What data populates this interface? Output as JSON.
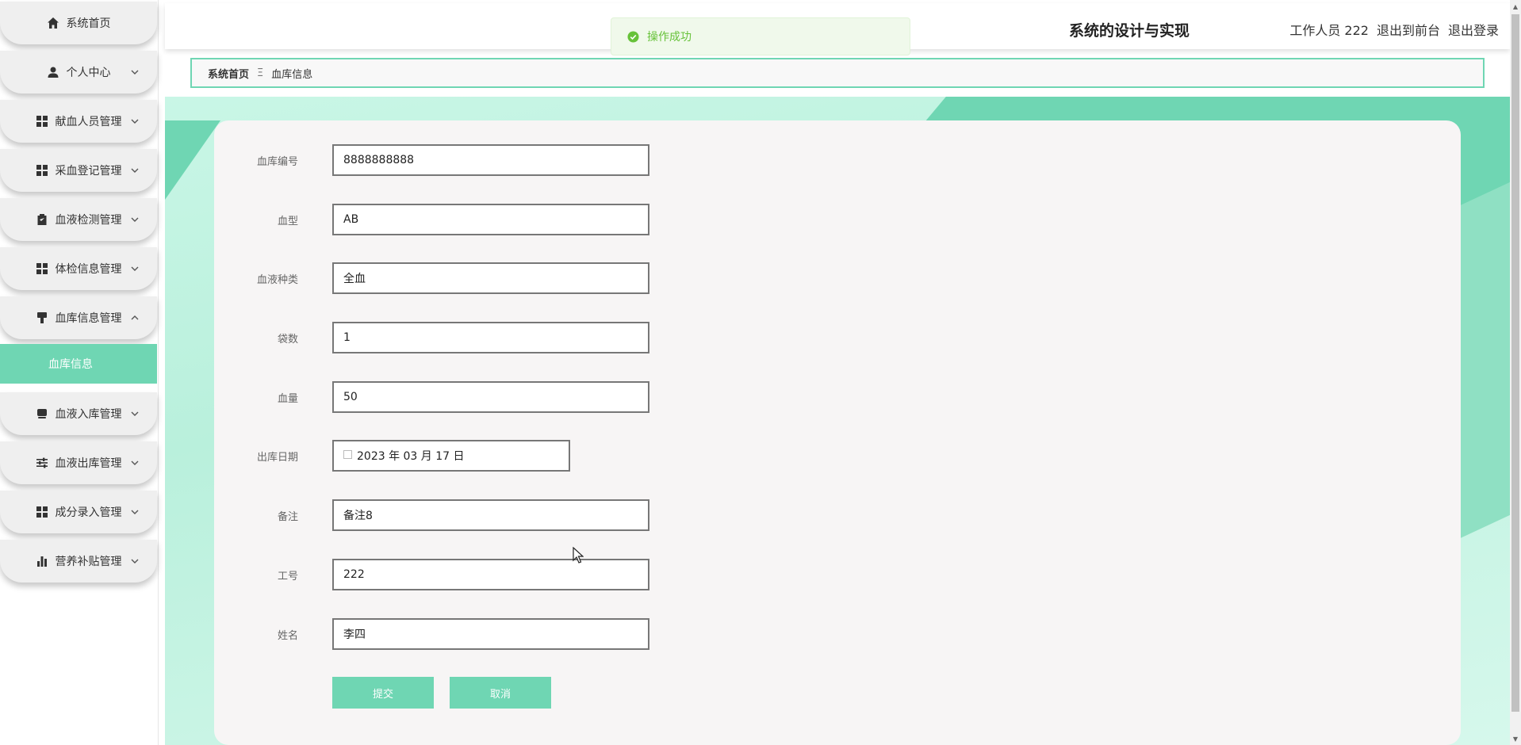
{
  "sidebar": {
    "items": [
      {
        "label": "系统首页",
        "icon": "home-icon",
        "has_chevron": false
      },
      {
        "label": "个人中心",
        "icon": "user-icon",
        "has_chevron": true
      },
      {
        "label": "献血人员管理",
        "icon": "grid-icon",
        "has_chevron": true
      },
      {
        "label": "采血登记管理",
        "icon": "grid-icon",
        "has_chevron": true
      },
      {
        "label": "血液检测管理",
        "icon": "clipboard-icon",
        "has_chevron": true
      },
      {
        "label": "体检信息管理",
        "icon": "grid-icon",
        "has_chevron": true
      },
      {
        "label": "血库信息管理",
        "icon": "brush-icon",
        "has_chevron": true,
        "expanded": true
      },
      {
        "label": "血液入库管理",
        "icon": "inbox-icon",
        "has_chevron": true
      },
      {
        "label": "血液出库管理",
        "icon": "sliders-icon",
        "has_chevron": true
      },
      {
        "label": "成分录入管理",
        "icon": "grid-icon",
        "has_chevron": true
      },
      {
        "label": "营养补贴管理",
        "icon": "bar-chart-icon",
        "has_chevron": true
      }
    ],
    "active_sub": "血库信息"
  },
  "header": {
    "title": "系统的设计与实现",
    "user": "工作人员 222",
    "to_front": "退出到前台",
    "logout": "退出登录"
  },
  "toast": {
    "message": "操作成功",
    "color": "#67c23a"
  },
  "breadcrumb": {
    "home": "系统首页",
    "separator": "Ξ",
    "current": "血库信息"
  },
  "form": {
    "fields": [
      {
        "label": "血库编号",
        "value": "8888888888"
      },
      {
        "label": "血型",
        "value": "AB"
      },
      {
        "label": "血液种类",
        "value": "全血"
      },
      {
        "label": "袋数",
        "value": "1"
      },
      {
        "label": "血量",
        "value": "50"
      },
      {
        "label": "出库日期",
        "value": "2023 年 03 月 17 日",
        "type": "date"
      },
      {
        "label": "备注",
        "value": "备注8"
      },
      {
        "label": "工号",
        "value": "222"
      },
      {
        "label": "姓名",
        "value": "李四"
      }
    ],
    "submit": "提交",
    "cancel": "取消"
  },
  "colors": {
    "accent": "#6fd6b3",
    "sidebar_item_bg": "#efefef"
  }
}
